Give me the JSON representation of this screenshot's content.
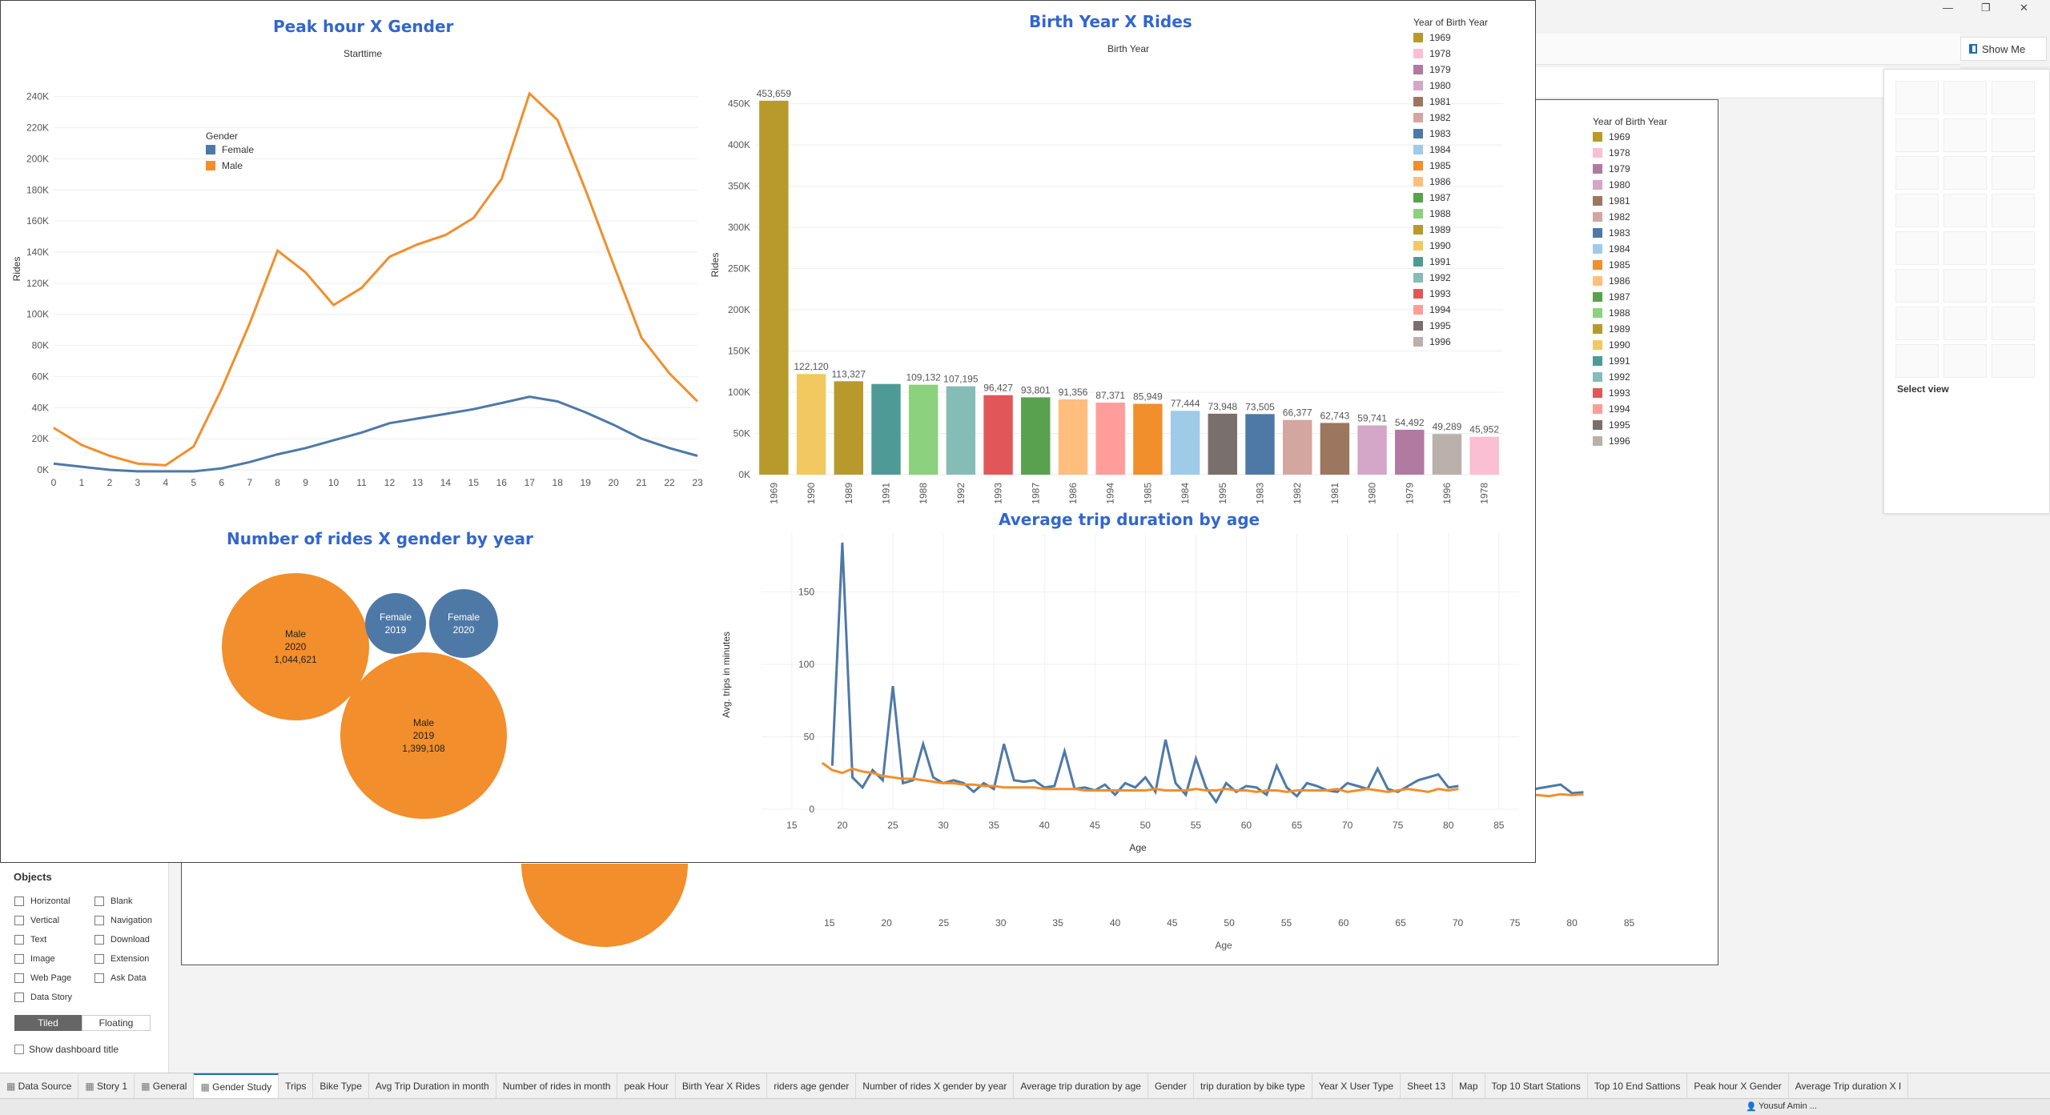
{
  "window": {
    "minimize": "—",
    "restore": "❐",
    "close": "✕"
  },
  "showme": {
    "label": "Show Me",
    "select_view": "Select view"
  },
  "objects_panel": {
    "title": "Objects",
    "items": [
      {
        "label": "Horizontal",
        "icon": "horizontal-icon"
      },
      {
        "label": "Blank",
        "icon": "blank-icon"
      },
      {
        "label": "Vertical",
        "icon": "vertical-icon"
      },
      {
        "label": "Navigation",
        "icon": "navigation-icon"
      },
      {
        "label": "Text",
        "icon": "text-icon"
      },
      {
        "label": "Download",
        "icon": "download-icon"
      },
      {
        "label": "Image",
        "icon": "image-icon"
      },
      {
        "label": "Extension",
        "icon": "extension-icon"
      },
      {
        "label": "Web Page",
        "icon": "web-page-icon"
      },
      {
        "label": "Ask Data",
        "icon": "ask-data-icon"
      },
      {
        "label": "Data Story",
        "icon": "data-story-icon"
      }
    ],
    "tiled": "Tiled",
    "floating": "Floating",
    "show_title": "Show dashboard title"
  },
  "tabs": [
    {
      "label": "Data Source",
      "icon": "database-icon"
    },
    {
      "label": "Story 1",
      "icon": "story-icon"
    },
    {
      "label": "General",
      "icon": "dashboard-icon"
    },
    {
      "label": "Gender Study",
      "icon": "dashboard-icon",
      "active": true
    },
    {
      "label": "Trips"
    },
    {
      "label": "Bike Type"
    },
    {
      "label": "Avg Trip Duration in month"
    },
    {
      "label": "Number of rides in month"
    },
    {
      "label": "peak Hour"
    },
    {
      "label": "Birth Year X Rides"
    },
    {
      "label": "riders age gender"
    },
    {
      "label": "Number of rides X gender by year"
    },
    {
      "label": "Average trip duration by age"
    },
    {
      "label": "Gender"
    },
    {
      "label": "trip duration by bike type"
    },
    {
      "label": "Year X User Type"
    },
    {
      "label": "Sheet 13"
    },
    {
      "label": "Map"
    },
    {
      "label": "Top 10 Start Stations"
    },
    {
      "label": "Top 10 End Sattions"
    },
    {
      "label": "Peak hour X Gender"
    },
    {
      "label": "Average Trip duration X I"
    }
  ],
  "status": {
    "user": "Yousuf Amin ..."
  },
  "colors": {
    "male": "#f28e2b",
    "female": "#4e79a7",
    "title_blue": "#3366cc"
  },
  "background_dashboard": {
    "legend_title": "Year of Birth Year",
    "bar_labels": [
      "59,741",
      "54,492",
      "49,289",
      "45,952"
    ],
    "bar_years": [
      "1980",
      "1979",
      "1996",
      "1978"
    ],
    "x_ticks": [
      "15",
      "20",
      "25",
      "30",
      "35",
      "40",
      "45",
      "50",
      "55",
      "60",
      "65",
      "70",
      "75",
      "80",
      "85"
    ],
    "x_label": "Age",
    "y_zero": "0"
  },
  "chart_data": [
    {
      "id": "peak-hour",
      "type": "line",
      "title": "Peak hour X Gender",
      "subtitle": "Starttime",
      "ylabel": "Rides",
      "xlabel": "",
      "x": [
        0,
        1,
        2,
        3,
        4,
        5,
        6,
        7,
        8,
        9,
        10,
        11,
        12,
        13,
        14,
        15,
        16,
        17,
        18,
        19,
        20,
        21,
        22,
        23
      ],
      "ylim": [
        0,
        250000
      ],
      "yticks": [
        "0K",
        "20K",
        "40K",
        "60K",
        "80K",
        "100K",
        "120K",
        "140K",
        "160K",
        "180K",
        "200K",
        "220K",
        "240K"
      ],
      "legend_title": "Gender",
      "series": [
        {
          "name": "Female",
          "color": "#4e79a7",
          "values": [
            4000,
            2000,
            0,
            -1000,
            -1000,
            -1000,
            1000,
            5000,
            10000,
            14000,
            19000,
            24000,
            30000,
            33000,
            36000,
            39000,
            43000,
            47000,
            44000,
            37000,
            29000,
            20000,
            14000,
            9000
          ]
        },
        {
          "name": "Male",
          "color": "#f28e2b",
          "values": [
            27000,
            16000,
            9000,
            4000,
            3000,
            15000,
            52000,
            94000,
            141000,
            127000,
            106000,
            117000,
            137000,
            145000,
            151000,
            162000,
            187000,
            242000,
            225000,
            180000,
            132000,
            85000,
            62000,
            44000
          ]
        }
      ]
    },
    {
      "id": "birth-year",
      "type": "bar",
      "title": "Birth Year X Rides",
      "subtitle": "Birth Year",
      "ylabel": "Rides",
      "ylim": [
        0,
        470000
      ],
      "yticks": [
        "0K",
        "50K",
        "100K",
        "150K",
        "200K",
        "250K",
        "300K",
        "350K",
        "400K",
        "450K"
      ],
      "categories": [
        "1969",
        "1990",
        "1989",
        "1991",
        "1988",
        "1992",
        "1993",
        "1987",
        "1986",
        "1994",
        "1985",
        "1984",
        "1995",
        "1983",
        "1982",
        "1981",
        "1980",
        "1979",
        "1996",
        "1978"
      ],
      "values": [
        453659,
        122120,
        113327,
        110000,
        109132,
        107195,
        96427,
        93801,
        91356,
        87371,
        85949,
        77444,
        73948,
        73505,
        66377,
        62743,
        59741,
        54492,
        49289,
        45952
      ],
      "labels": [
        "453,659",
        "122,120",
        "113,327",
        "",
        "109,132",
        "107,195",
        "96,427",
        "93,801",
        "91,356",
        "87,371",
        "85,949",
        "77,444",
        "73,948",
        "73,505",
        "66,377",
        "62,743",
        "59,741",
        "54,492",
        "49,289",
        "45,952"
      ],
      "colors": [
        "#b89a2c",
        "#f2c960",
        "#b89a2c",
        "#4e9a96",
        "#8cd17d",
        "#86bcb6",
        "#e15759",
        "#59a14f",
        "#ffbe7d",
        "#ff9d9a",
        "#f28e2b",
        "#a0cbe8",
        "#79706e",
        "#4e79a7",
        "#d4a6a0",
        "#9d7660",
        "#d4a6c8",
        "#b07aa1",
        "#bab0ac",
        "#fabfd2"
      ],
      "legend_title": "Year of Birth Year",
      "legend": [
        {
          "label": "1969",
          "color": "#b89a2c"
        },
        {
          "label": "1978",
          "color": "#fabfd2"
        },
        {
          "label": "1979",
          "color": "#b07aa1"
        },
        {
          "label": "1980",
          "color": "#d4a6c8"
        },
        {
          "label": "1981",
          "color": "#9d7660"
        },
        {
          "label": "1982",
          "color": "#d4a6a0"
        },
        {
          "label": "1983",
          "color": "#4e79a7"
        },
        {
          "label": "1984",
          "color": "#a0cbe8"
        },
        {
          "label": "1985",
          "color": "#f28e2b"
        },
        {
          "label": "1986",
          "color": "#ffbe7d"
        },
        {
          "label": "1987",
          "color": "#59a14f"
        },
        {
          "label": "1988",
          "color": "#8cd17d"
        },
        {
          "label": "1989",
          "color": "#b89a2c"
        },
        {
          "label": "1990",
          "color": "#f2c960"
        },
        {
          "label": "1991",
          "color": "#4e9a96"
        },
        {
          "label": "1992",
          "color": "#86bcb6"
        },
        {
          "label": "1993",
          "color": "#e15759"
        },
        {
          "label": "1994",
          "color": "#ff9d9a"
        },
        {
          "label": "1995",
          "color": "#79706e"
        },
        {
          "label": "1996",
          "color": "#bab0ac"
        }
      ]
    },
    {
      "id": "rides-gender-year",
      "type": "bubble",
      "title": "Number of rides X gender by year",
      "bubbles": [
        {
          "gender": "Male",
          "year": "2020",
          "value": 1044621,
          "label": "1,044,621",
          "color": "#f28e2b"
        },
        {
          "gender": "Female",
          "year": "2019",
          "value": null,
          "label": "",
          "color": "#4e79a7"
        },
        {
          "gender": "Female",
          "year": "2020",
          "value": null,
          "label": "",
          "color": "#4e79a7"
        },
        {
          "gender": "Male",
          "year": "2019",
          "value": 1399108,
          "label": "1,399,108",
          "color": "#f28e2b"
        }
      ]
    },
    {
      "id": "avg-duration-age",
      "type": "line",
      "title": "Average trip duration by age",
      "ylabel": "Avg. trips in minutes",
      "xlabel": "Age",
      "xlim": [
        12,
        87
      ],
      "ylim": [
        0,
        190
      ],
      "xticks": [
        15,
        20,
        25,
        30,
        35,
        40,
        45,
        50,
        55,
        60,
        65,
        70,
        75,
        80,
        85
      ],
      "yticks": [
        0,
        50,
        100,
        150
      ],
      "series": [
        {
          "name": "Female",
          "color": "#4e79a7",
          "x": [
            19,
            20,
            21,
            22,
            23,
            24,
            25,
            26,
            27,
            28,
            29,
            30,
            31,
            32,
            33,
            34,
            35,
            36,
            37,
            38,
            39,
            40,
            41,
            42,
            43,
            44,
            45,
            46,
            47,
            48,
            49,
            50,
            51,
            52,
            53,
            54,
            55,
            56,
            57,
            58,
            59,
            60,
            61,
            62,
            63,
            64,
            65,
            66,
            67,
            68,
            69,
            70,
            71,
            72,
            73,
            74,
            75,
            76,
            77,
            78,
            79,
            80,
            81
          ],
          "values": [
            30,
            184,
            22,
            15,
            27,
            20,
            85,
            18,
            20,
            45,
            22,
            18,
            20,
            18,
            12,
            18,
            14,
            45,
            20,
            19,
            20,
            15,
            16,
            40,
            14,
            15,
            13,
            17,
            10,
            18,
            15,
            22,
            12,
            48,
            18,
            10,
            35,
            15,
            5,
            18,
            12,
            16,
            15,
            10,
            30,
            15,
            9,
            18,
            16,
            13,
            12,
            18,
            16,
            14,
            28,
            14,
            12,
            16,
            20,
            22,
            24,
            15,
            16
          ]
        },
        {
          "name": "Male",
          "color": "#f28e2b",
          "x": [
            18,
            19,
            20,
            21,
            22,
            23,
            24,
            25,
            26,
            27,
            28,
            29,
            30,
            31,
            32,
            33,
            34,
            35,
            36,
            37,
            38,
            39,
            40,
            41,
            42,
            43,
            44,
            45,
            46,
            47,
            48,
            49,
            50,
            51,
            52,
            53,
            54,
            55,
            56,
            57,
            58,
            59,
            60,
            61,
            62,
            63,
            64,
            65,
            66,
            67,
            68,
            69,
            70,
            71,
            72,
            73,
            74,
            75,
            76,
            77,
            78,
            79,
            80,
            81
          ],
          "values": [
            32,
            27,
            25,
            28,
            26,
            25,
            23,
            22,
            21,
            21,
            20,
            19,
            18,
            18,
            17,
            17,
            16,
            16,
            15,
            15,
            15,
            15,
            14,
            14,
            14,
            14,
            13,
            13,
            13,
            13,
            13,
            13,
            13,
            14,
            13,
            13,
            13,
            14,
            13,
            13,
            14,
            13,
            13,
            12,
            13,
            13,
            12,
            13,
            13,
            13,
            13,
            14,
            12,
            13,
            14,
            13,
            12,
            13,
            14,
            13,
            12,
            14,
            13,
            14
          ]
        }
      ]
    }
  ]
}
